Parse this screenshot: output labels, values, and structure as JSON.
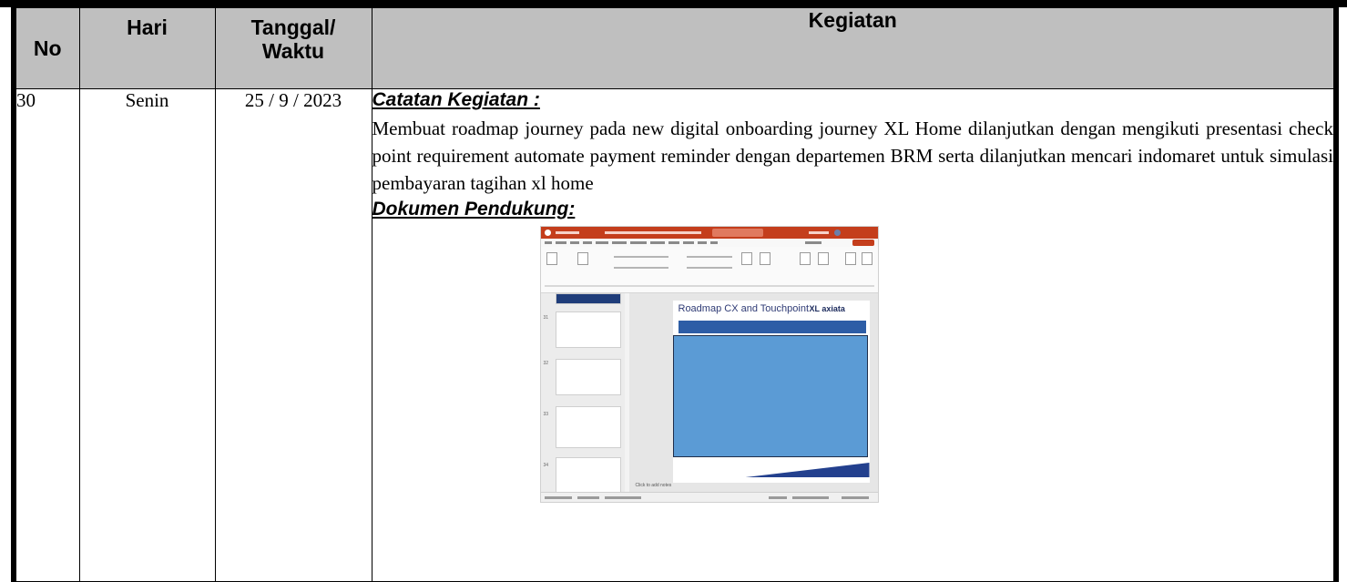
{
  "table": {
    "headers": {
      "no": "No",
      "hari": "Hari",
      "tanggal_line1": "Tanggal/",
      "tanggal_line2": "Waktu",
      "kegiatan": "Kegiatan"
    },
    "rows": [
      {
        "no": "30",
        "hari": "Senin",
        "tanggal": "25 / 9 / 2023",
        "catatan_heading": "Catatan Kegiatan :",
        "catatan_text": "Membuat roadmap journey pada new digital onboarding journey XL Home dilanjutkan dengan mengikuti presentasi check point requirement automate payment reminder dengan departemen BRM serta dilanjutkan mencari indomaret untuk simulasi pembayaran tagihan xl home",
        "dokumen_heading": "Dokumen Pendukung:",
        "screenshot": {
          "slide_title": "Roadmap CX and Touchpoint",
          "brand": "XL axiata",
          "notes_placeholder": "Click to add notes",
          "app_color": "#c43e1c",
          "slide_box_color": "#5b9bd5"
        }
      }
    ]
  }
}
